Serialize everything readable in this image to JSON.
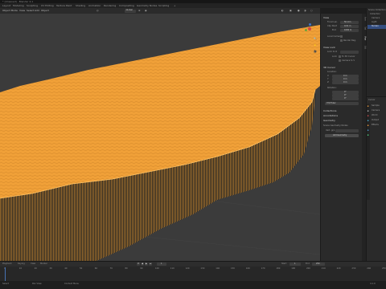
{
  "app": {
    "title": "* (Unsaved) - Blender 4.1"
  },
  "workspaces": [
    "Layout",
    "Modeling",
    "Sculpting",
    "UV Editing",
    "Texture Paint",
    "Shading",
    "Animation",
    "Rendering",
    "Compositing",
    "Geometry Nodes",
    "Scripting",
    "+"
  ],
  "viewport_header": {
    "mode": "Object Mode",
    "menus": [
      "View",
      "Select",
      "Add",
      "Object"
    ],
    "transform": "Global"
  },
  "npanel": {
    "view_section": "View",
    "focal_length_label": "Focal Len.",
    "focal_length": "50 mm",
    "clip_start_label": "Clip Start",
    "clip_start": "0.01 m",
    "clip_end_label": "End",
    "clip_end": "1000 m",
    "local_camera_label": "Local Camera",
    "render_region_label": "Render Reg.",
    "view_lock_section": "View Lock",
    "lock_to_object_label": "Lock to O",
    "lock_label": "Lock",
    "to_3d_cursor": "To 3D Cursor",
    "camera_to_view": "Camera to V",
    "cursor_section": "3D Cursor",
    "location_label": "Location:",
    "x_label": "X",
    "x_value": "0 m",
    "y_label": "Y",
    "y_value": "0 m",
    "z_label": "Z",
    "z_value": "0 m",
    "rotation_label": "Rotation:",
    "rx_value": "0°",
    "ry_value": "0°",
    "rz_value": "0°",
    "rotation_mode": "XYZ Euler",
    "collections_section": "Collections",
    "annotations_section": "Annotations",
    "geometry_section": "Geometry",
    "scene_section": "Scene Geometry Nodes",
    "vertex_group_label": "Vert. grp",
    "add_btn": "Add Geometry"
  },
  "tabs": [
    "Item",
    "Tool",
    "View",
    "Edit"
  ],
  "outliner": {
    "items": [
      "Scene Collection",
      "Collection",
      "Camera",
      "Light",
      "Terrain"
    ]
  },
  "properties": {
    "label": "Cursor",
    "rows": [
      "Sample",
      "Camera",
      "World",
      "Output",
      "Effects"
    ]
  },
  "timeline": {
    "frame_ticks": [
      "0",
      "10",
      "20",
      "30",
      "40",
      "50",
      "60",
      "70",
      "80",
      "90",
      "100",
      "110",
      "120",
      "130",
      "140",
      "150",
      "160",
      "170",
      "180",
      "190",
      "200",
      "210",
      "220",
      "230",
      "240",
      "250"
    ],
    "current_frame": "1",
    "start_label": "Start",
    "start": "1",
    "end_label": "End",
    "end": "250",
    "menus": [
      "Playback",
      "Keying",
      "View",
      "Marker"
    ]
  },
  "status": {
    "left": "Select",
    "center": "Pan View",
    "right": "Context Menu",
    "version": "4.1.0"
  },
  "colors": {
    "terrain": "#f0a038",
    "accent": "#4772b3"
  }
}
